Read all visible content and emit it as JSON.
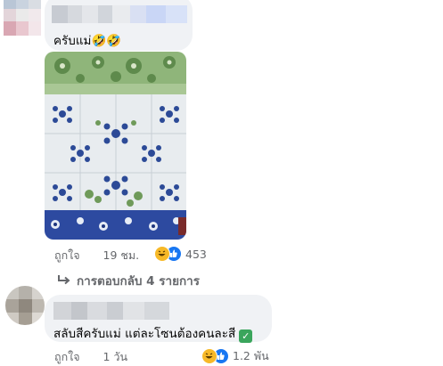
{
  "comments": [
    {
      "text": "ครับแม่🤣🤣",
      "meta": {
        "like_label": "ถูกใจ",
        "time": "19 ชม.",
        "reaction_count": "453"
      }
    },
    {
      "text": "สลับสีครับแม่ แต่ละโซนต้องคนละสี",
      "meta": {
        "like_label": "ถูกใจ",
        "time": "1 วัน",
        "reaction_count": "1.2 พัน"
      }
    }
  ],
  "replies": {
    "label": "การตอบกลับ 4 รายการ"
  },
  "icons": {
    "reactions": [
      "laugh-icon",
      "like-icon"
    ],
    "reply_arrow": "reply-arrow-icon",
    "check": "check-mark-icon",
    "photo": "floor-tile-photo"
  },
  "colors": {
    "bubble": "#f0f2f5",
    "meta_text": "#65676b",
    "like_blue": "#1877f2",
    "laugh_yellow": "#f7b928",
    "check_green": "#3aa55c"
  }
}
